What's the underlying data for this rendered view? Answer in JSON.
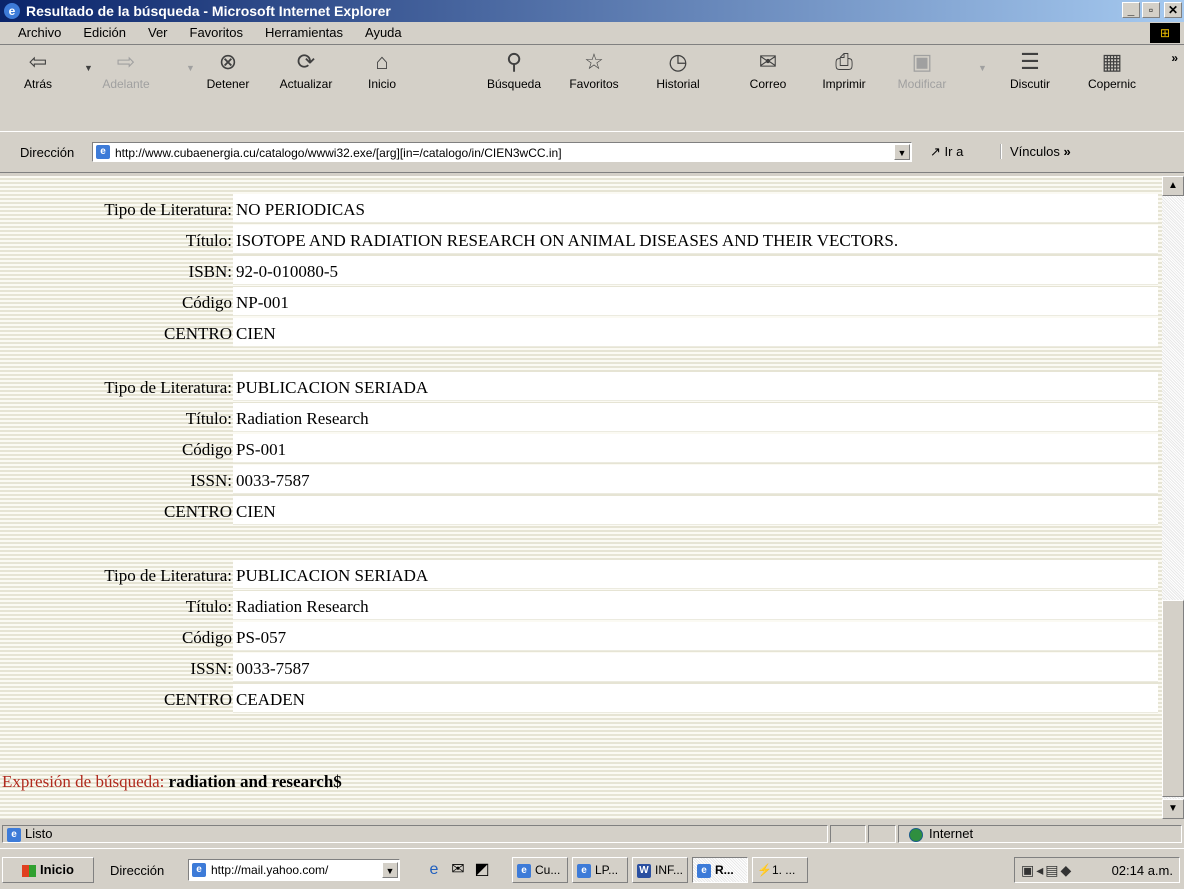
{
  "window": {
    "title": "Resultado de la búsqueda - Microsoft Internet Explorer"
  },
  "menu": [
    "Archivo",
    "Edición",
    "Ver",
    "Favoritos",
    "Herramientas",
    "Ayuda"
  ],
  "toolbar": {
    "back": "Atrás",
    "forward": "Adelante",
    "stop": "Detener",
    "refresh": "Actualizar",
    "home": "Inicio",
    "search": "Búsqueda",
    "favorites": "Favoritos",
    "history": "Historial",
    "mail": "Correo",
    "print": "Imprimir",
    "edit": "Modificar",
    "discuss": "Discutir",
    "copernic": "Copernic"
  },
  "address": {
    "label": "Dirección",
    "url": "http://www.cubaenergia.cu/catalogo/wwwi32.exe/[arg][in=/catalogo/in/CIEN3wCC.in]",
    "go": "Ir a",
    "links": "Vínculos"
  },
  "records": [
    {
      "fields": [
        {
          "label": "Tipo de Literatura:",
          "value": "NO PERIODICAS"
        },
        {
          "label": "Título:",
          "value": "ISOTOPE AND RADIATION RESEARCH ON ANIMAL DISEASES AND THEIR VECTORS."
        },
        {
          "label": "ISBN:",
          "value": "92-0-010080-5"
        },
        {
          "label": "Código",
          "value": "NP-001"
        },
        {
          "label": "CENTRO",
          "value": "CIEN"
        }
      ]
    },
    {
      "fields": [
        {
          "label": "Tipo de Literatura:",
          "value": "PUBLICACION SERIADA"
        },
        {
          "label": "Título:",
          "value": "Radiation Research"
        },
        {
          "label": "Código",
          "value": "PS-001"
        },
        {
          "label": "ISSN:",
          "value": "0033-7587"
        },
        {
          "label": "CENTRO",
          "value": "CIEN"
        }
      ]
    },
    {
      "fields": [
        {
          "label": "Tipo de Literatura:",
          "value": "PUBLICACION SERIADA"
        },
        {
          "label": "Título:",
          "value": "Radiation Research"
        },
        {
          "label": "Código",
          "value": "PS-057"
        },
        {
          "label": "ISSN:",
          "value": "0033-7587"
        },
        {
          "label": "CENTRO",
          "value": "CEADEN"
        }
      ]
    }
  ],
  "expression": {
    "label": "Expresión de búsqueda:",
    "value": "radiation and research$"
  },
  "status": {
    "text": "Listo",
    "zone": "Internet"
  },
  "taskbar": {
    "start": "Inicio",
    "address_label": "Dirección",
    "address_url": "http://mail.yahoo.com/",
    "tasks": [
      "Cu...",
      "LP...",
      "INF...",
      "R...",
      "1. ..."
    ],
    "clock": "02:14 a.m."
  },
  "colors": {
    "title_bar": "#0a246a",
    "expression_label": "#b02a1e",
    "content_stripe": "#e6e4d4"
  }
}
